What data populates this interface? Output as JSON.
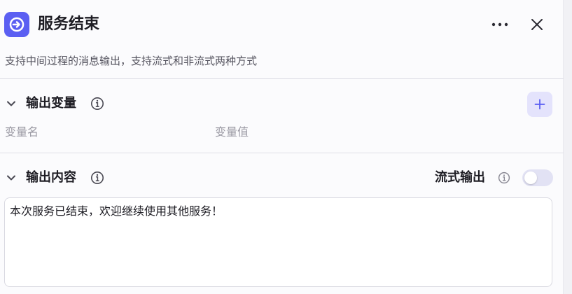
{
  "header": {
    "title": "服务结束",
    "description": "支持中间过程的消息输出，支持流式和非流式两种方式",
    "icons": {
      "app": "exit-arrow-icon",
      "more": "more-horizontal-icon",
      "close": "close-icon"
    }
  },
  "output_variables": {
    "title": "输出变量",
    "columns": {
      "name": "变量名",
      "value": "变量值"
    },
    "icons": {
      "collapse": "chevron-down-icon",
      "info": "info-icon",
      "add": "plus-icon"
    }
  },
  "output_content": {
    "title": "输出内容",
    "streaming_label": "流式输出",
    "streaming_enabled": false,
    "content": "本次服务已结束，欢迎继续使用其他服务！",
    "icons": {
      "collapse": "chevron-down-icon",
      "info": "info-icon"
    }
  },
  "colors": {
    "accent": "#5b5ff2",
    "accent_soft": "#e4e3fc",
    "text": "#1d1c23",
    "muted": "#9a99a3"
  }
}
